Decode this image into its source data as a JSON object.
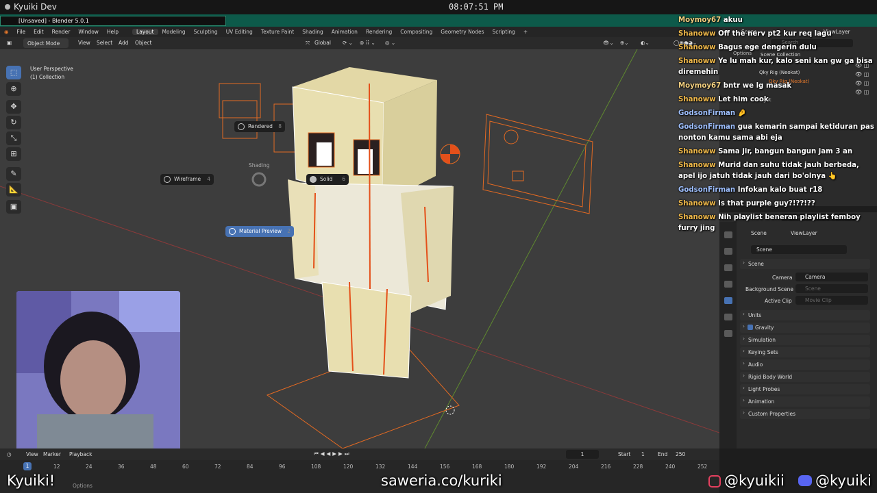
{
  "os": {
    "title": "Kyuiki Dev",
    "clock": "08:07:51 PM"
  },
  "window": {
    "title": "[Unsaved] - Blender 5.0.1"
  },
  "menu": {
    "items": [
      "File",
      "Edit",
      "Render",
      "Window",
      "Help"
    ],
    "workspaces": [
      "Layout",
      "Modeling",
      "Sculpting",
      "UV Editing",
      "Texture Paint",
      "Shading",
      "Animation",
      "Rendering",
      "Compositing",
      "Geometry Nodes",
      "Scripting"
    ],
    "active_workspace": "Layout",
    "add_tab": "+"
  },
  "header": {
    "mode": "Object Mode",
    "view": "View",
    "select": "Select",
    "add": "Add",
    "object": "Object",
    "orientation": "Global"
  },
  "viewport": {
    "perspective": "User Perspective",
    "collection": "(1) Collection",
    "pie": {
      "title": "Shading",
      "rendered": "Rendered",
      "rendered_key": "8",
      "wireframe": "Wireframe",
      "wireframe_key": "4",
      "solid": "Solid",
      "solid_key": "6",
      "material": "Material Preview",
      "material_key": "2"
    }
  },
  "chat": [
    {
      "user": "Moymoy67",
      "msg": "akuu"
    },
    {
      "user": "Shanoww",
      "msg": "Off the nerv pt2 kur req lagu"
    },
    {
      "user": "Shanoww",
      "msg": "Bagus ege dengerin dulu"
    },
    {
      "user": "Shanoww",
      "msg": "Ye lu mah kur, kalo seni kan gw ga bisa diremehin"
    },
    {
      "user": "Moymoy67",
      "msg": "bntr we lg masak"
    },
    {
      "user": "Shanoww",
      "msg": "Let him cook"
    },
    {
      "user": "GodsonFirman",
      "msg": "🤌"
    },
    {
      "user": "GodsonFirman",
      "msg": "gua kemarin sampai ketiduran pas nonton kamu sama abi eja"
    },
    {
      "user": "Shanoww",
      "msg": "Sama jir, bangun bangun jam 3 an"
    },
    {
      "user": "Shanoww",
      "msg": "Murid dan suhu tidak jauh berbeda, apel ijo jatuh tidak jauh dari bo'olnya 👆"
    },
    {
      "user": "GodsonFirman",
      "msg": "Infokan kalo buat r18"
    },
    {
      "user": "Shanoww",
      "msg": "Is that purple guy?!??!??"
    },
    {
      "user": "Shanoww",
      "msg": "Nih playlist beneran playlist femboy furry jing"
    }
  ],
  "outliner": {
    "header": "Scene",
    "view_layer": "ViewLayer",
    "search": "Search",
    "options": "Options",
    "scene_collection": "Scene Collection",
    "items": [
      "Qky Rig (Neokat)",
      "Qky Rig (Neokat)",
      "Light"
    ]
  },
  "properties": {
    "search": "Search",
    "breadcrumb_scene": "Scene",
    "breadcrumb_layer": "ViewLayer",
    "scene_name": "Scene",
    "section": "Scene",
    "camera_label": "Camera",
    "camera_value": "Camera",
    "bg_label": "Background Scene",
    "bg_placeholder": "Scene",
    "clip_label": "Active Clip",
    "clip_placeholder": "Movie Clip",
    "sections": [
      "Units",
      "Gravity",
      "Simulation",
      "Keying Sets",
      "Audio",
      "Rigid Body World",
      "Light Probes",
      "Animation",
      "Custom Properties"
    ]
  },
  "timeline": {
    "view": "View",
    "marker": "Marker",
    "playback": "Playback",
    "current": "1",
    "start_label": "Start",
    "start": "1",
    "end_label": "End",
    "end": "250",
    "ticks": [
      "12",
      "24",
      "36",
      "48",
      "60",
      "72",
      "84",
      "96",
      "108",
      "120",
      "132",
      "144",
      "156",
      "168",
      "180",
      "192",
      "204",
      "216",
      "228",
      "240",
      "252"
    ],
    "cursor": "1",
    "options": "Options"
  },
  "overlay": {
    "left": "Kyuiki!",
    "center": "saweria.co/kuriki",
    "instagram": "@kyuikii",
    "discord": "@kyuiki"
  },
  "colors": {
    "accent": "#4772b3",
    "window_bar": "#0d5a4a",
    "selection_orange": "#e8792b"
  }
}
